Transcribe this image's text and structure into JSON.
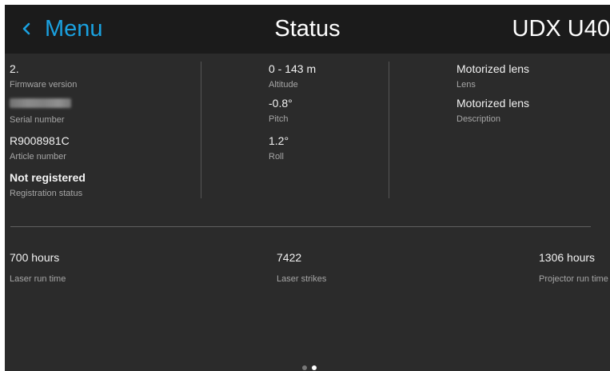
{
  "header": {
    "back_label": "Menu",
    "title": "Status",
    "model": "UDX U40"
  },
  "columns": {
    "left": [
      {
        "value": "2.",
        "label": "Firmware version"
      },
      {
        "value": "",
        "label": "Serial number",
        "redacted": true
      },
      {
        "value": "R9008981C",
        "label": "Article number"
      },
      {
        "value": "Not registered",
        "label": "Registration status"
      }
    ],
    "middle": [
      {
        "value": "0 - 143 m",
        "label": "Altitude"
      },
      {
        "value": "-0.8°",
        "label": "Pitch"
      },
      {
        "value": "1.2°",
        "label": "Roll"
      }
    ],
    "right": [
      {
        "value": "Motorized lens",
        "label": "Lens"
      },
      {
        "value": "Motorized lens",
        "label": "Description"
      }
    ]
  },
  "counters": [
    {
      "value": "700 hours",
      "label": "Laser run time"
    },
    {
      "value": "7422",
      "label": "Laser strikes"
    },
    {
      "value": "1306 hours",
      "label": "Projector run time"
    }
  ],
  "pager": {
    "pages": 2,
    "current": 2
  },
  "colors": {
    "accent": "#1aa1e0",
    "background": "#2b2b2b",
    "header": "#1b1b1b"
  }
}
